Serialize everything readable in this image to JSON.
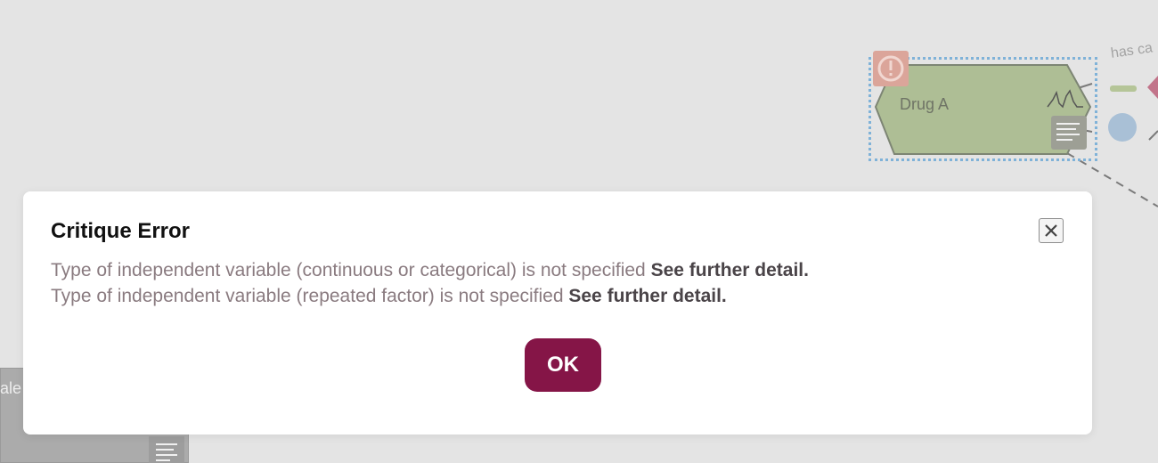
{
  "canvas": {
    "node_label": "Drug A",
    "edge_label": "has ca",
    "left_node_label": "ale"
  },
  "dialog": {
    "title": "Critique Error",
    "messages": [
      {
        "text": "Type of independent variable (continuous or categorical) is not specified",
        "link": "See further detail."
      },
      {
        "text": "Type of independent variable (repeated factor) is not specified",
        "link": "See further detail."
      }
    ],
    "ok_label": "OK",
    "close_icon": "close-icon"
  },
  "colors": {
    "ok_button": "#851547",
    "message_text": "#8a7b80",
    "node_fill": "#aebe95",
    "selection_outline": "#7fb2d8"
  }
}
